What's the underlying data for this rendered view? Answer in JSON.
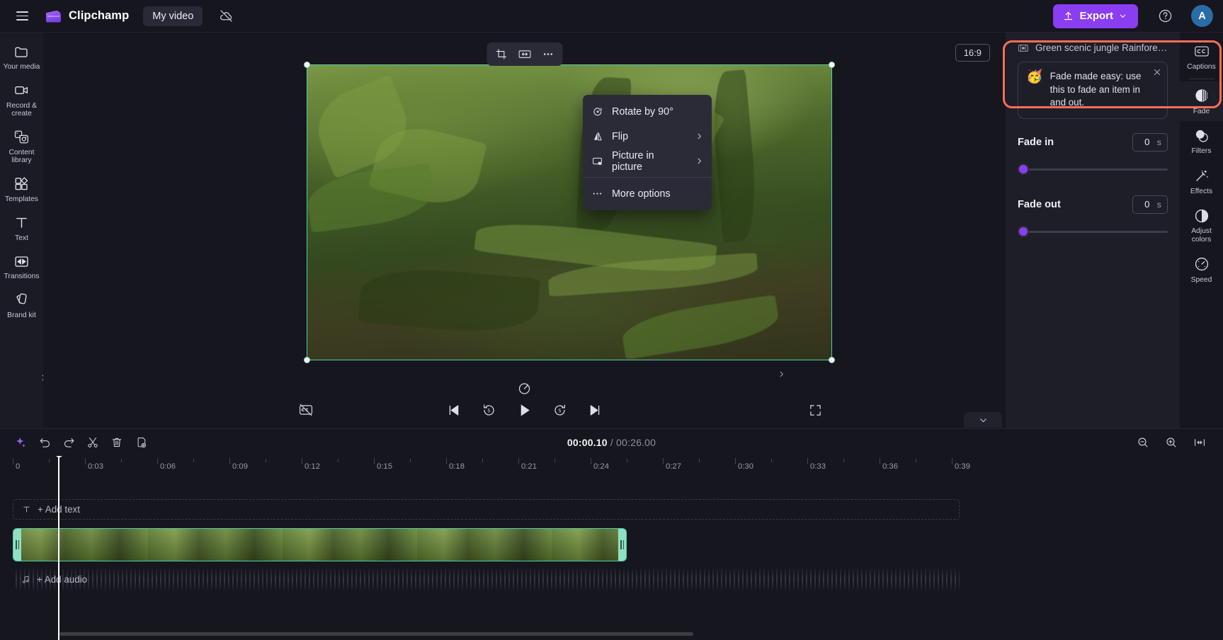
{
  "app": {
    "brand_name": "Clipchamp",
    "project_name": "My video",
    "menu_icon": "hamburger-icon",
    "cloud_icon": "cloud-off-icon",
    "export_label": "Export",
    "help_icon": "help-circle-icon",
    "avatar_initial": "A",
    "accent_color": "#8b3df2",
    "highlight_color": "#ff6d5a",
    "selection_color": "#4fd0a8"
  },
  "left_rail": {
    "items": [
      {
        "label": "Your media",
        "icon": "folder-icon"
      },
      {
        "label": "Record & create",
        "icon": "video-camera-icon"
      },
      {
        "label": "Content library",
        "icon": "content-library-icon"
      },
      {
        "label": "Templates",
        "icon": "templates-icon"
      },
      {
        "label": "Text",
        "icon": "text-icon"
      },
      {
        "label": "Transitions",
        "icon": "transitions-icon"
      },
      {
        "label": "Brand kit",
        "icon": "brand-kit-icon"
      }
    ],
    "expand_icon": "chevron-right-icon"
  },
  "stage": {
    "aspect_ratio": "16:9",
    "float_tools": [
      {
        "icon": "crop-icon",
        "name": "crop-button"
      },
      {
        "icon": "fit-icon",
        "name": "fit-button"
      },
      {
        "icon": "more-icon",
        "name": "more-button"
      }
    ],
    "rotate_handle_icon": "rotate-handle-icon",
    "collapse_panel_icon": "chevron-right-icon"
  },
  "context_menu": {
    "items": [
      {
        "label": "Rotate by 90°",
        "icon": "rotate-90-icon",
        "submenu": false
      },
      {
        "label": "Flip",
        "icon": "flip-icon",
        "submenu": true
      },
      {
        "label": "Picture in picture",
        "icon": "picture-in-picture-icon",
        "submenu": true
      },
      {
        "label": "More options",
        "icon": "more-options-icon",
        "submenu": false
      }
    ]
  },
  "playback": {
    "captions_off_icon": "captions-off-icon",
    "controls": [
      {
        "icon": "skip-previous-icon",
        "name": "skip-to-start-button"
      },
      {
        "icon": "rewind-5-icon",
        "name": "rewind-5-seconds-button"
      },
      {
        "icon": "play-icon",
        "name": "play-button"
      },
      {
        "icon": "forward-5-icon",
        "name": "forward-5-seconds-button"
      },
      {
        "icon": "skip-next-icon",
        "name": "skip-to-end-button"
      }
    ],
    "fullscreen_icon": "fullscreen-icon"
  },
  "properties": {
    "clip_icon": "film-strip-icon",
    "clip_title": "Green scenic jungle Rainforest A...",
    "tip": {
      "emoji": "🥳",
      "text": "Fade made easy: use this to fade an item in and out.",
      "close_icon": "close-icon"
    },
    "fade_in": {
      "label": "Fade in",
      "value": "0",
      "unit": "s",
      "slider_percent": 0
    },
    "fade_out": {
      "label": "Fade out",
      "value": "0",
      "unit": "s",
      "slider_percent": 0
    }
  },
  "right_rail": {
    "items": [
      {
        "label": "Captions",
        "icon": "closed-captions-icon",
        "active": false
      },
      {
        "label": "Fade",
        "icon": "fade-icon",
        "active": true
      },
      {
        "label": "Filters",
        "icon": "filters-icon",
        "active": false
      },
      {
        "label": "Effects",
        "icon": "effects-wand-icon",
        "active": false
      },
      {
        "label": "Adjust colors",
        "icon": "adjust-colors-icon",
        "active": false
      },
      {
        "label": "Speed",
        "icon": "speed-gauge-icon",
        "active": false
      }
    ]
  },
  "timeline": {
    "collapse_icon": "chevron-down-icon",
    "toolbar": [
      {
        "icon": "magic-sparkle-icon",
        "name": "auto-compose-button"
      },
      {
        "icon": "undo-icon",
        "name": "undo-button"
      },
      {
        "icon": "redo-icon",
        "name": "redo-button"
      },
      {
        "icon": "scissors-icon",
        "name": "split-button"
      },
      {
        "icon": "trash-icon",
        "name": "delete-button"
      },
      {
        "icon": "duplicate-icon",
        "name": "duplicate-button"
      }
    ],
    "current_time": "00:00.10",
    "total_time": "00:26.00",
    "time_separator": "/",
    "zoom_controls": [
      {
        "icon": "zoom-out-icon",
        "name": "zoom-out-button"
      },
      {
        "icon": "zoom-in-icon",
        "name": "zoom-in-button"
      },
      {
        "icon": "fit-timeline-icon",
        "name": "fit-to-timeline-button"
      }
    ],
    "ruler_labels": [
      "0",
      "0:03",
      "0:06",
      "0:09",
      "0:12",
      "0:15",
      "0:18",
      "0:21",
      "0:24",
      "0:27",
      "0:30",
      "0:33",
      "0:36",
      "0:39"
    ],
    "text_track": {
      "label": "+ Add text",
      "icon": "text-t-icon"
    },
    "audio_track": {
      "label": "+ Add audio",
      "icon": "music-note-icon"
    },
    "video_clip": {
      "selected": true,
      "left_handle": "trim-left-handle",
      "right_handle": "trim-right-handle"
    }
  }
}
